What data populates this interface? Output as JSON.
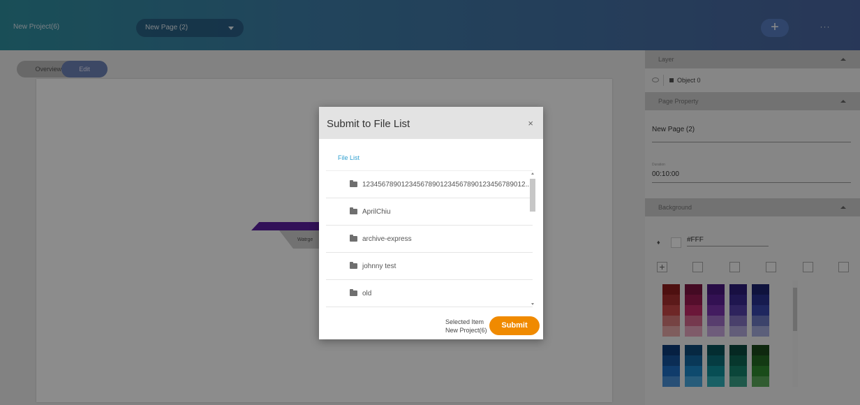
{
  "topbar": {
    "project_name": "New Project(6)",
    "page_select": "New Page (2)",
    "add_label": "+",
    "more_label": "···"
  },
  "mode": {
    "overview_label": "Overview",
    "edit_label": "Edit"
  },
  "canvas": {
    "shape_text": "Watrge"
  },
  "panel": {
    "layer": {
      "header": "Layer",
      "object_label": "Object 0"
    },
    "page_property": {
      "header": "Page Property",
      "page_name": "New Page (2)",
      "duration_label": "Duration",
      "duration_value": "00:10:00"
    },
    "background": {
      "header": "Background",
      "hex_value": "#FFF"
    }
  },
  "modal": {
    "title": "Submit to File List",
    "close_label": "×",
    "file_list_label": "File List",
    "items": [
      "1234567890123456789012345678901234567890​12...",
      "AprilChiu",
      "archive-express",
      "johnny test",
      "old"
    ],
    "selected_item_label": "Selected Item",
    "selected_item_value": "New Project(6)",
    "submit_label": "Submit"
  },
  "colors": {
    "accent_orange": "#f08a00",
    "link_blue": "#2f9fd0"
  }
}
